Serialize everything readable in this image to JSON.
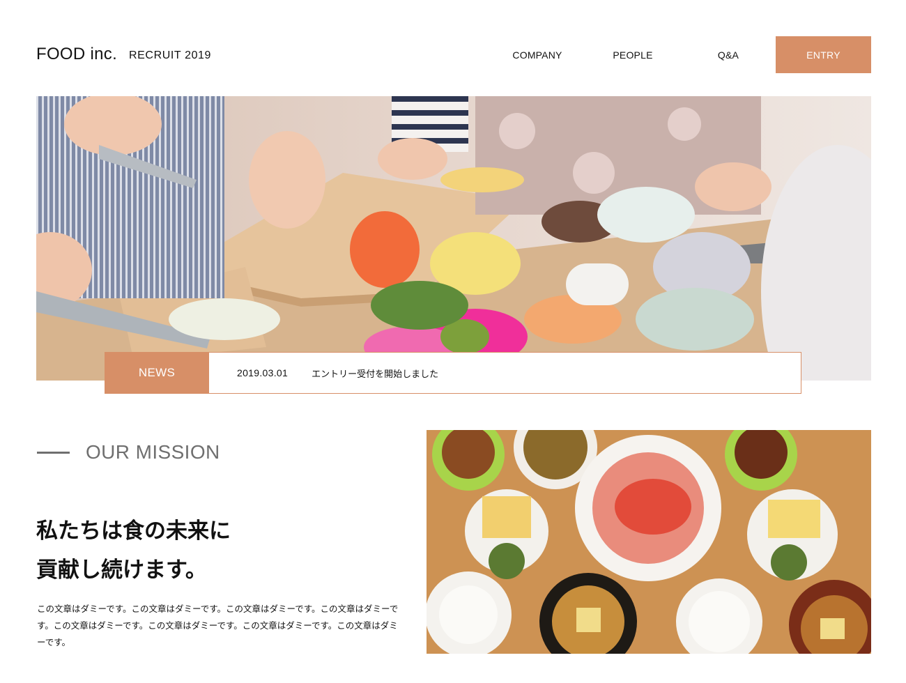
{
  "header": {
    "logo": "FOOD inc.",
    "subtitle": "RECRUIT 2019",
    "nav": {
      "company": "COMPANY",
      "people": "PEOPLE",
      "qa": "Q&A"
    },
    "entry_label": "ENTRY"
  },
  "news": {
    "label": "NEWS",
    "date": "2019.03.01",
    "text": "エントリー受付を開始しました"
  },
  "mission": {
    "label": "OUR MISSION",
    "heading_line1": "私たちは食の未来に",
    "heading_line2": "貢献し続けます。",
    "body": "この文章はダミーです。この文章はダミーです。この文章はダミーです。この文章はダミーです。この文章はダミーです。この文章はダミーです。この文章はダミーです。この文章はダミーです。"
  },
  "colors": {
    "accent": "#d78f67",
    "muted_text": "#6f6f6f"
  }
}
